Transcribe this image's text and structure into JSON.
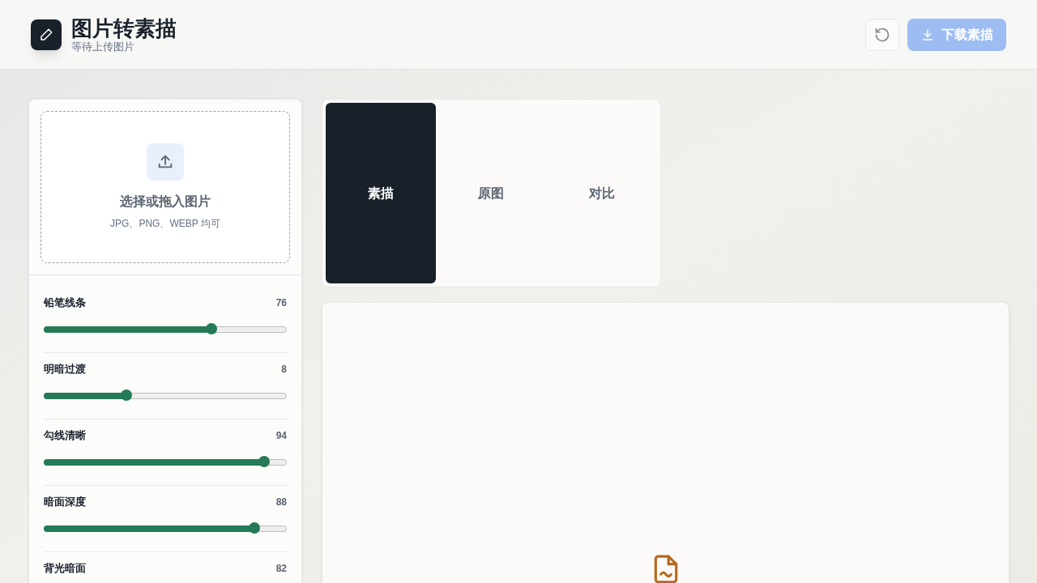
{
  "header": {
    "title": "图片转素描",
    "subtitle": "等待上传图片",
    "download_button": {
      "label": "下载素描",
      "disabled": true
    }
  },
  "upload": {
    "title": "选择或拖入图片",
    "hint": "JPG、PNG、WEBP 均可"
  },
  "sliders": [
    {
      "label": "铅笔线条",
      "reading": "76",
      "level": 0.69
    },
    {
      "label": "明暗过渡",
      "reading": "8",
      "level": 0.34
    },
    {
      "label": "勾线清晰",
      "reading": "94",
      "level": 0.91
    },
    {
      "label": "暗面深度",
      "reading": "88",
      "level": 0.87
    },
    {
      "label": "背光暗面",
      "reading": "82"
    }
  ],
  "tabs": [
    {
      "label": "素描",
      "selected": true
    },
    {
      "label": "原图",
      "selected": false
    },
    {
      "label": "对比",
      "selected": false
    }
  ]
}
